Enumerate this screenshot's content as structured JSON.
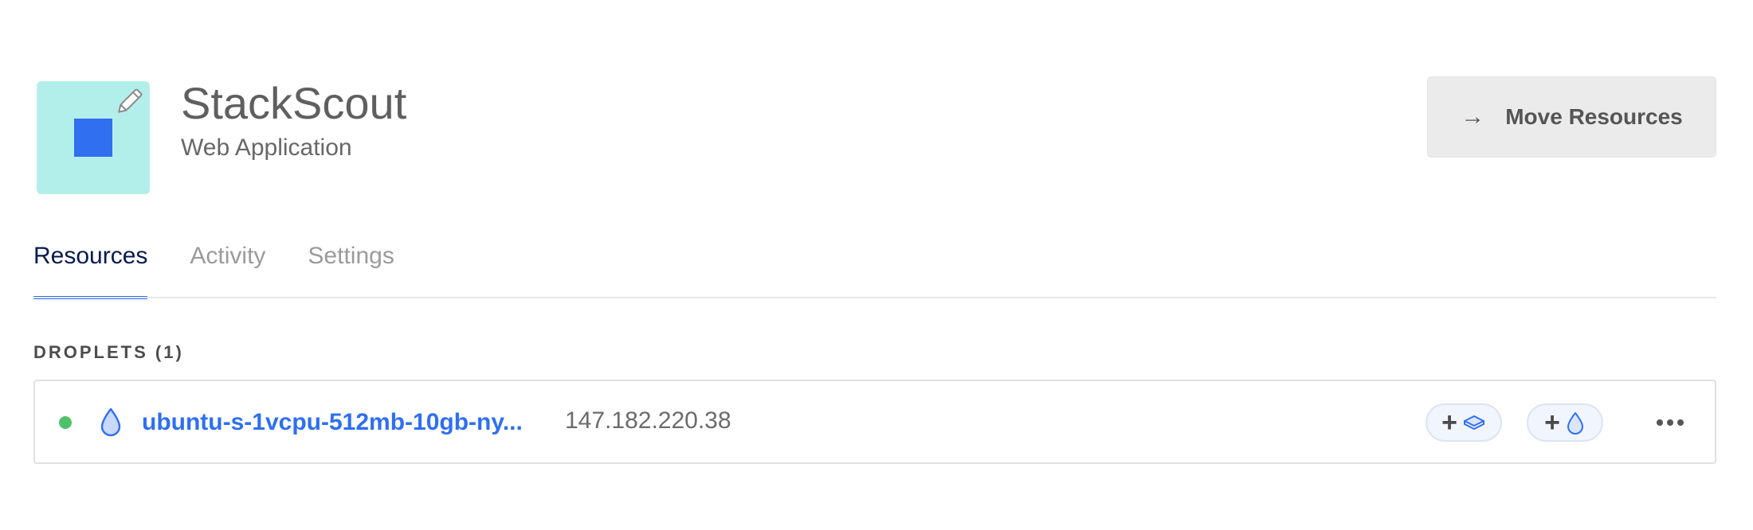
{
  "project": {
    "name": "StackScout",
    "subtitle": "Web Application",
    "icon_color": "#b3efea",
    "icon_square_color": "#2f6ff0"
  },
  "actions": {
    "move_resources_label": "Move Resources",
    "move_resources_icon": "arrow-right-icon"
  },
  "tabs": [
    {
      "label": "Resources",
      "active": true
    },
    {
      "label": "Activity",
      "active": false
    },
    {
      "label": "Settings",
      "active": false
    }
  ],
  "droplets": {
    "section_title": "DROPLETS (1)",
    "items": [
      {
        "name": "ubuntu-s-1vcpu-512mb-10gb-ny...",
        "ip": "147.182.220.38",
        "status": "active",
        "status_color": "#4fc16b"
      }
    ],
    "add_volume_icon": "add-volume-icon",
    "add_droplet_icon": "add-droplet-icon",
    "more_icon": "ellipsis-icon"
  },
  "colors": {
    "accent": "#2f6ff0",
    "active_tab": "#061a4e"
  }
}
